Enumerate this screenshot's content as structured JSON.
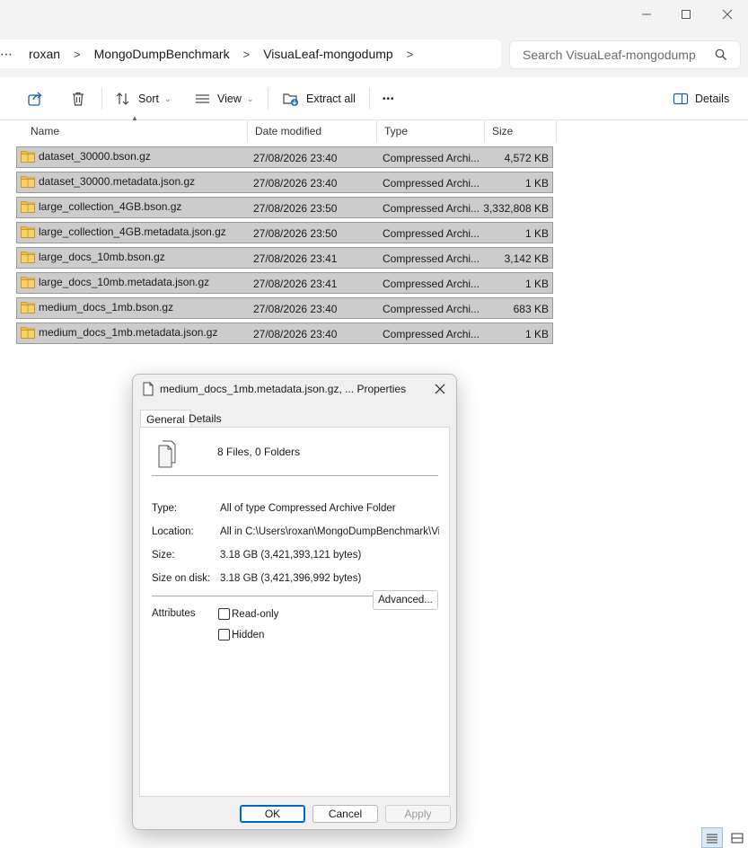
{
  "window": {
    "controls": {
      "minimize": "minimize-icon",
      "maximize": "maximize-icon",
      "close": "close-icon"
    }
  },
  "breadcrumb": {
    "overflow": "⋯",
    "items": [
      "roxan",
      "MongoDumpBenchmark",
      "VisuaLeaf-mongodump"
    ],
    "separator": ">"
  },
  "search": {
    "placeholder": "Search VisuaLeaf-mongodump"
  },
  "toolbar": {
    "share_icon": "share-icon",
    "delete_icon": "trash-icon",
    "sort_label": "Sort",
    "view_label": "View",
    "extract_label": "Extract all",
    "more_label": "•••",
    "details_label": "Details"
  },
  "columns": {
    "name": "Name",
    "date": "Date modified",
    "type": "Type",
    "size": "Size"
  },
  "files": [
    {
      "name": "dataset_30000.bson.gz",
      "date": "27/08/2026 23:40",
      "type": "Compressed Archi...",
      "size": "4,572 KB"
    },
    {
      "name": "dataset_30000.metadata.json.gz",
      "date": "27/08/2026 23:40",
      "type": "Compressed Archi...",
      "size": "1 KB"
    },
    {
      "name": "large_collection_4GB.bson.gz",
      "date": "27/08/2026 23:50",
      "type": "Compressed Archi...",
      "size": "3,332,808 KB"
    },
    {
      "name": "large_collection_4GB.metadata.json.gz",
      "date": "27/08/2026 23:50",
      "type": "Compressed Archi...",
      "size": "1 KB"
    },
    {
      "name": "large_docs_10mb.bson.gz",
      "date": "27/08/2026 23:41",
      "type": "Compressed Archi...",
      "size": "3,142 KB"
    },
    {
      "name": "large_docs_10mb.metadata.json.gz",
      "date": "27/08/2026 23:41",
      "type": "Compressed Archi...",
      "size": "1 KB"
    },
    {
      "name": "medium_docs_1mb.bson.gz",
      "date": "27/08/2026 23:40",
      "type": "Compressed Archi...",
      "size": "683 KB"
    },
    {
      "name": "medium_docs_1mb.metadata.json.gz",
      "date": "27/08/2026 23:40",
      "type": "Compressed Archi...",
      "size": "1 KB"
    }
  ],
  "dialog": {
    "title": "medium_docs_1mb.metadata.json.gz, ... Properties",
    "tabs": [
      "General",
      "Details"
    ],
    "summary": "8 Files, 0 Folders",
    "type_label": "Type:",
    "type_value": "All of type Compressed Archive Folder",
    "location_label": "Location:",
    "location_value": "All in C:\\Users\\roxan\\MongoDumpBenchmark\\VisuaLeaf-mongodump",
    "size_label": "Size:",
    "size_value": "3.18 GB (3,421,393,121 bytes)",
    "size_on_disk_label": "Size on disk:",
    "size_on_disk_value": "3.18 GB (3,421,396,992 bytes)",
    "attributes_label": "Attributes",
    "readonly_label": "Read-only",
    "hidden_label": "Hidden",
    "advanced_label": "Advanced...",
    "ok_label": "OK",
    "cancel_label": "Cancel",
    "apply_label": "Apply"
  },
  "statusbar": {
    "details_view_icon": "details-view-icon",
    "tiles_view_icon": "tiles-view-icon"
  },
  "colors": {
    "selection": "#cccccc",
    "selection_border": "#9a9a9a",
    "accent": "#0067c0",
    "folder_zip": "#e8b43a"
  }
}
